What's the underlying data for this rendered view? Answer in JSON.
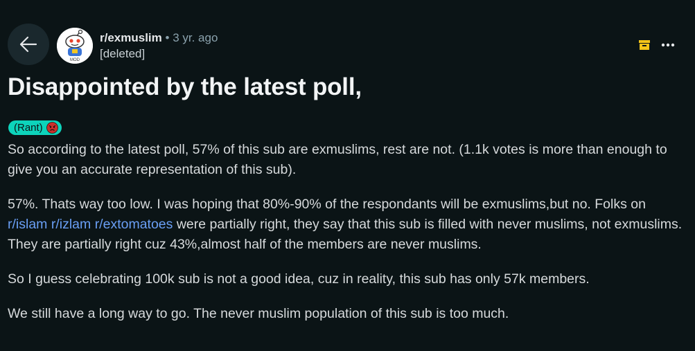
{
  "header": {
    "subreddit": "r/exmuslim",
    "separator": "•",
    "time_ago": "3 yr. ago",
    "author": "[deleted]"
  },
  "icons": {
    "back": "back-arrow-icon",
    "save": "save-archive-icon",
    "more": "more-options-icon",
    "avatar": "subreddit-snoo-avatar",
    "flair_emoji": "angry-face-icon"
  },
  "post": {
    "title": "Disappointed by the latest poll,",
    "flair": "(Rant)",
    "paragraphs": {
      "p1": "So according to the latest poll, 57% of this sub are exmuslims, rest are not. (1.1k votes is more than enough to give you an accurate representation of this sub).",
      "p2_start": "57%. Thats way too low. I was hoping that 80%-90% of the respondants will be exmuslims,but no. Folks on ",
      "link1": "r/islam",
      "link2": "r/izlam",
      "link3": "r/extomatoes",
      "p2_end": " were partially right, they say that this sub is filled with never muslims, not exmuslims. They are partially right cuz 43%,almost half of the members are never muslims.",
      "p3": "So I guess celebrating 100k sub is not a good idea, cuz in reality, this sub has only 57k members.",
      "p4": "We still have a long way to go. The never muslim population of this sub is too much."
    }
  },
  "colors": {
    "background": "#0b1416",
    "flair_bg": "#0dd3bb",
    "link": "#6a9ff5",
    "save_icon": "#f5c518"
  }
}
